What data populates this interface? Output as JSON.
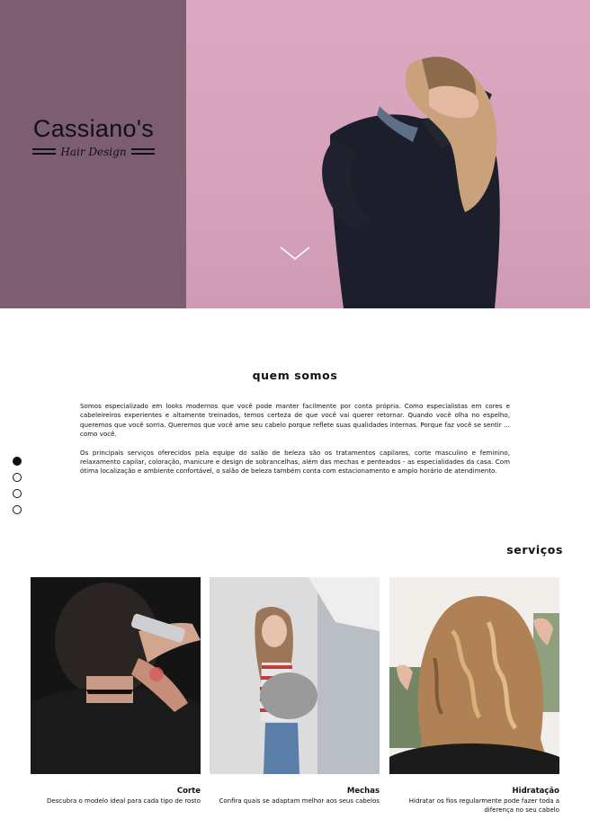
{
  "brand": {
    "name": "Cassiano's",
    "tagline": "Hair Design"
  },
  "colors": {
    "hero_left": "#7d5d70",
    "hero_right": "#dca9c2"
  },
  "hero": {
    "scroll_icon": "chevron-down-icon"
  },
  "about": {
    "title": "quem somos",
    "paragraphs": [
      "Somos especializado em looks modernos que você pode manter facilmente por conta própria. Como especialistas em cores e cabeleireiros experientes e altamente treinados, temos certeza de que você vai querer retornar. Quando você olha no espelho, queremos que você sorria. Queremos que você ame seu cabelo porque reflete suas qualidades internas. Porque faz você se sentir ... como você.",
      "Os principais serviços oferecidos pela equipe do salão de beleza são os tratamentos capilares, corte masculino e feminino, relaxamento capilar, coloração, manicure e design de sobrancelhas, além das mechas e penteados - as especialidades da casa. Com ótima localização e ambiente confortável, o salão de beleza também conta com estacionamento e amplo horário de atendimento."
    ]
  },
  "nav_dots": {
    "count": 4,
    "active_index": 0
  },
  "services": {
    "title": "serviços",
    "items": [
      {
        "title": "Corte",
        "description": "Descubra o modelo ideal para cada tipo de rosto"
      },
      {
        "title": "Mechas",
        "description": "Confira quais se adaptam melhor aos seus cabelos"
      },
      {
        "title": "Hidratação",
        "description": "Hidratar os fios regularmente pode fazer toda a diferença no seu cabelo"
      }
    ]
  }
}
